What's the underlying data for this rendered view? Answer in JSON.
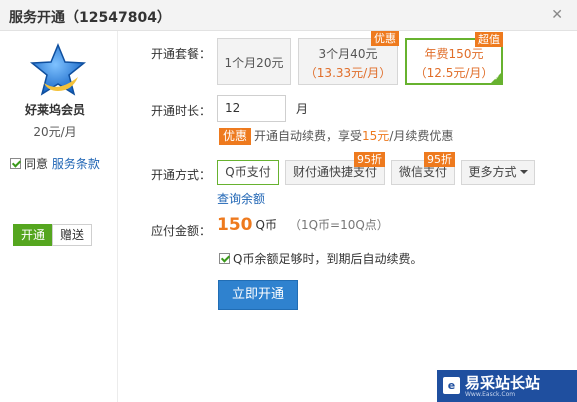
{
  "window": {
    "title": "服务开通（12547804）",
    "close_icon": "✕"
  },
  "sidebar": {
    "member_name": "好莱坞会员",
    "price": "20元/月",
    "agree_text": "同意",
    "agree_link": "服务条款",
    "tabs": [
      {
        "label": "开通"
      },
      {
        "label": "赠送"
      }
    ]
  },
  "package": {
    "label": "开通套餐：",
    "options": [
      {
        "line1": "1个月20元",
        "line2": "",
        "tag": "",
        "selected": false
      },
      {
        "line1": "3个月40元",
        "line2": "（13.33元/月）",
        "tag": "优惠",
        "selected": false
      },
      {
        "line1": "年费150元",
        "line2": "（12.5元/月）",
        "tag": "超值",
        "selected": true
      }
    ]
  },
  "duration": {
    "label": "开通时长：",
    "value": "12",
    "unit": "月",
    "promo_badge": "优惠",
    "promo_before": "开通自动续费，享受",
    "promo_highlight": "15元",
    "promo_after": "/月续费优惠"
  },
  "payment": {
    "label": "开通方式：",
    "methods": [
      {
        "label": "Q币支付",
        "tag": "",
        "selected": true
      },
      {
        "label": "财付通快捷支付",
        "tag": "95折",
        "selected": false
      },
      {
        "label": "微信支付",
        "tag": "95折",
        "selected": false
      },
      {
        "label": "更多方式",
        "tag": "",
        "selected": false
      }
    ],
    "balance_link": "查询余额"
  },
  "amount": {
    "label": "应付金额：",
    "value": "150",
    "unit": "Q币",
    "note": "（1Q币=10Q点）"
  },
  "auto_renew": {
    "text": "Q币余额足够时，到期后自动续费。"
  },
  "submit": {
    "label": "立即开通"
  },
  "watermark": {
    "icon": "e",
    "text": "易采站长站",
    "sub": "Www.Easck.Com"
  },
  "colors": {
    "accent_green": "#55a61f",
    "accent_orange": "#ee7a1e",
    "button_blue": "#2f82cf"
  }
}
